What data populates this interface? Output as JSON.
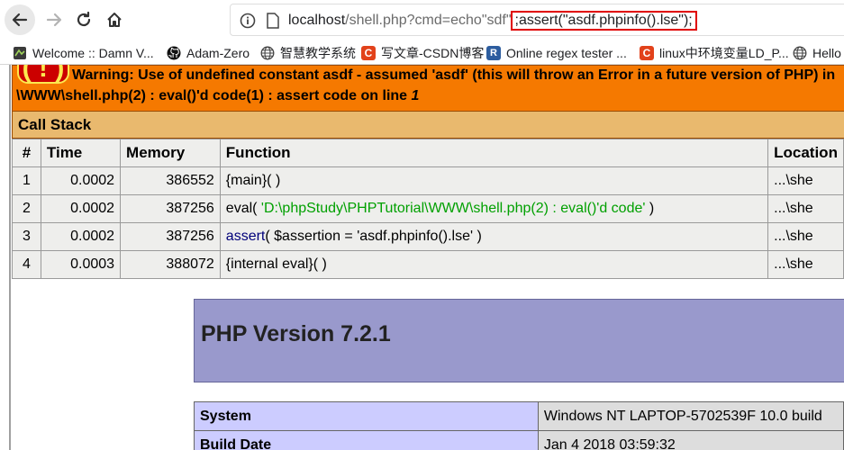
{
  "browser": {
    "url": {
      "host": "localhost",
      "path": "/shell.php?cmd=echo\"sdf\"",
      "highlighted": ";assert(\"asdf.phpinfo().lse\");"
    }
  },
  "bookmarks": [
    {
      "label": "Welcome :: Damn V...",
      "icon": "dvwa-icon"
    },
    {
      "label": "Adam-Zero",
      "icon": "github-icon"
    },
    {
      "label": "智慧教学系统",
      "icon": "globe-icon"
    },
    {
      "label": "写文章-CSDN博客",
      "icon": "csdn-icon",
      "glyph": "C"
    },
    {
      "label": "Online regex tester ...",
      "icon": "regex101-icon",
      "glyph": "R"
    },
    {
      "label": "linux中环境变量LD_P...",
      "icon": "csdn-icon",
      "glyph": "C"
    },
    {
      "label": "Hello",
      "icon": "globe-icon"
    }
  ],
  "warning": {
    "icon": "( ! )",
    "line1": "Warning: Use of undefined constant asdf - assumed 'asdf' (this will throw an Error in a future version of PHP) in",
    "line2_prefix": "\\WWW\\shell.php(2) : eval()'d code(1) : assert code on line ",
    "line2_num": "1"
  },
  "call_stack": {
    "title": "Call Stack",
    "headers": [
      "#",
      "Time",
      "Memory",
      "Function",
      "Location"
    ],
    "rows": [
      {
        "num": "1",
        "time": "0.0002",
        "memory": "386552",
        "fn_a": "{main}( )",
        "fn_b": "",
        "fn_c": "",
        "loc": "...\\she"
      },
      {
        "num": "2",
        "time": "0.0002",
        "memory": "387256",
        "fn_a": "eval( ",
        "fn_b": "'D:\\phpStudy\\PHPTutorial\\WWW\\shell.php(2) : eval()'d code'",
        "fn_c": " )",
        "loc": "...\\she"
      },
      {
        "num": "3",
        "time": "0.0002",
        "memory": "387256",
        "fn_a": "assert",
        "fn_b": "( $assertion = 'asdf.phpinfo().lse' )",
        "fn_c": "",
        "loc": "...\\she"
      },
      {
        "num": "4",
        "time": "0.0003",
        "memory": "388072",
        "fn_a": "{internal eval}( )",
        "fn_b": "",
        "fn_c": "",
        "loc": "...\\she"
      }
    ]
  },
  "phpinfo": {
    "version_title": "PHP Version 7.2.1",
    "rows": [
      {
        "key": "System",
        "value": "Windows NT LAPTOP-5702539F 10.0 build"
      },
      {
        "key": "Build Date",
        "value": "Jan 4 2018 03:59:32"
      }
    ]
  }
}
